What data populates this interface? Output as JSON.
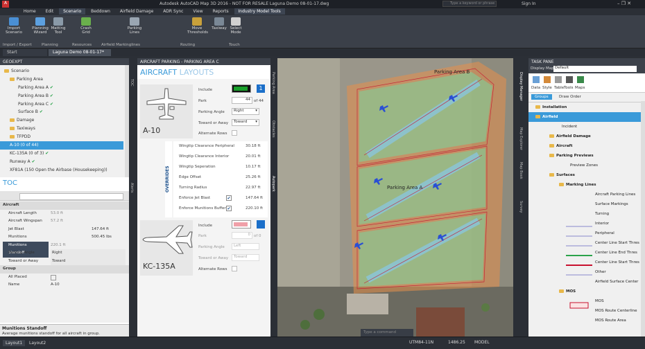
{
  "titlebar": {
    "text": "Autodesk AutoCAD Map 3D 2016 - NOT FOR RESALE   Laguna Demo 08-01-17.dwg",
    "search": "Type a keyword or phrase",
    "sign_in": "Sign In"
  },
  "menu": [
    "Home",
    "Edit",
    "Scenario",
    "Beddown",
    "Airfield Damage",
    "ADR Sync",
    "View",
    "Reports",
    "Industry Model Tools"
  ],
  "ribbon": {
    "buttons": [
      "Import Scenario",
      "Planning Wizard",
      "Matting Tool",
      "Crash Grid",
      "Parking Lines",
      "Move Thresholds",
      "Taxiway",
      "Select Mode"
    ],
    "groups": [
      "Import / Export",
      "Planning",
      "Resources",
      "Airfield Markinglines",
      "Routing",
      "Touch"
    ]
  },
  "doc_tabs": [
    "Start",
    "Laguna Demo 08-01-17*"
  ],
  "geoexpt": {
    "title": "GEOEXPT",
    "items": [
      "Scenario",
      "Parking Area",
      "Parking Area A",
      "Parking Area B",
      "Parking Area C",
      "Surface B",
      "Damage",
      "Taxiways",
      "TFPDD",
      "A-10 (0 of 44)",
      "KC-135A (0 of 3)",
      "Runway A",
      "XF81A (150 Open the Airbase (Housekeeping))"
    ]
  },
  "toc": {
    "title": "TOC",
    "section_aircraft": "Aircraft",
    "section_group": "Group",
    "rows": [
      [
        "Aircraft Length",
        "53.0 ft"
      ],
      [
        "Aircraft Wingspan",
        "57.2 ft"
      ],
      [
        "Jet Blast",
        "147.64 ft"
      ],
      [
        "Munitions",
        "500.45 lbs"
      ],
      [
        "Munitions Standoff",
        "220.1 ft"
      ],
      [
        "Parking Angle",
        "Right"
      ],
      [
        "Toward or Away",
        "Toward"
      ]
    ],
    "group_rows": [
      [
        "All Placed",
        ""
      ],
      [
        "Name",
        "A-10"
      ]
    ],
    "help_title": "Munitions Standoff",
    "help_text": "Average munitions standoff for all aircraft in group."
  },
  "aircraft_panel": {
    "header": "AIRCRAFT PARKING - PARKING AREA C",
    "title_a": "AIRCRAFT",
    "title_b": " LAYOUTS",
    "a10": {
      "name": "A-10",
      "include": "Include",
      "park": "Park",
      "park_val": "44",
      "park_of": "of 44",
      "angle": "Parking Angle",
      "angle_val": "Right",
      "toward": "Toward or Away",
      "toward_val": "Toward",
      "alt": "Alternate Rows",
      "badge": "1"
    },
    "overrides_label": "OVERRIDES",
    "overrides": [
      [
        "Wingtip Clearance Peripheral",
        "30.18 ft"
      ],
      [
        "Wingtip Clearance Interior",
        "20.01 ft"
      ],
      [
        "Wingtip Seperation",
        "10.17 ft"
      ],
      [
        "Edge Offset",
        "25.26 ft"
      ],
      [
        "Turning Radius",
        "22.97 ft"
      ],
      [
        "Enforce Jet Blast",
        "147.64 ft"
      ],
      [
        "Enforce Munitions Buffer",
        "220.10 ft"
      ]
    ],
    "kc": {
      "name": "KC-135A",
      "include": "Include",
      "park": "Park",
      "park_val": "0",
      "park_of": "of 0",
      "angle": "Parking Angle",
      "angle_val": "Left",
      "toward": "Toward or Away",
      "toward_val": "Toward",
      "alt": "Alternate Rows"
    }
  },
  "map": {
    "label_b": "Parking Area B",
    "label_a": "Parking Area A",
    "side_tabs": [
      "Parking Area",
      "Obstacles",
      "Autopark"
    ],
    "right_tabs": [
      "Display Manager",
      "Map Explorer",
      "Map Book",
      "Survey"
    ]
  },
  "taskpane": {
    "title": "TASK PANE",
    "display_map_label": "Display Map:",
    "display_map_val": "Default",
    "tools": [
      "Data",
      "Style",
      "Table",
      "Tools",
      "Maps"
    ],
    "groups_btn": "Groups",
    "draw_order": "Draw Order",
    "layers": [
      "Installation",
      "Airfield",
      "Incident",
      "Airfield Damage",
      "Aircraft",
      "Parking Previews",
      "Preview Zones",
      "Surfaces",
      "Marking Lines",
      "Aircraft Parking Lines",
      "Surface Markings",
      "Turning",
      "Interior",
      "Peripheral",
      "Center Line Start Thres",
      "Center Line End Thres",
      "Center Line Start Thres",
      "Other",
      "Airfield Surface Center",
      "MOS",
      "MOS",
      "MOS Route Centerline",
      "MOS Route Area"
    ]
  },
  "status": {
    "layouts": [
      "Layout1",
      "Layout2"
    ],
    "coords": "UTM84-11N",
    "scale": "1486.25",
    "model": "MODEL",
    "command": "Type a command"
  }
}
